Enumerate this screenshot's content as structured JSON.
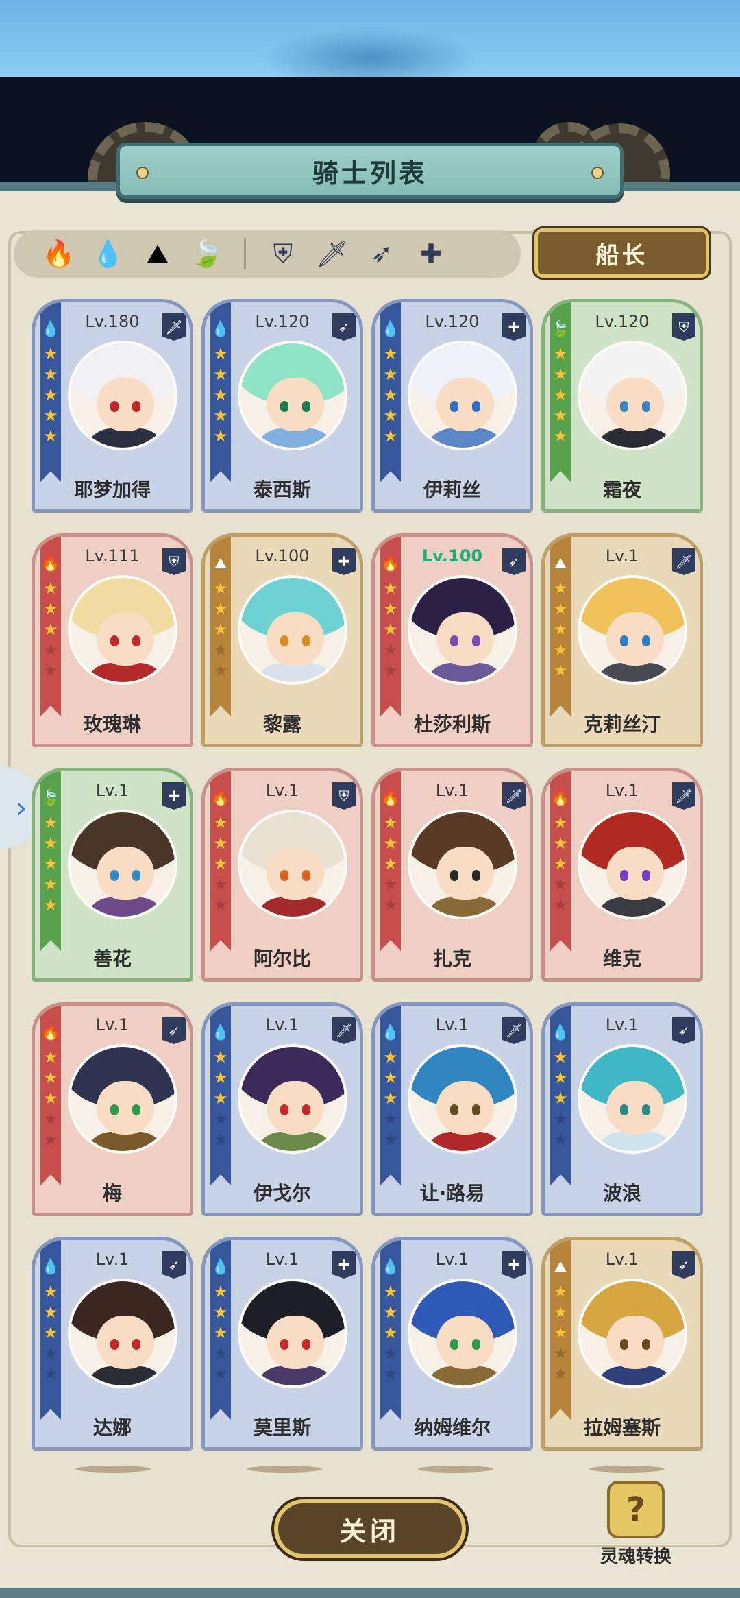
{
  "window": {
    "title": "骑士列表"
  },
  "filters": {
    "elements": [
      {
        "name": "fire",
        "glyph": "🔥"
      },
      {
        "name": "water",
        "glyph": "💧"
      },
      {
        "name": "earth",
        "glyph": "⛰"
      },
      {
        "name": "wind",
        "glyph": "🍃"
      }
    ],
    "classes": [
      {
        "name": "shield",
        "glyph": "⛨"
      },
      {
        "name": "sword",
        "glyph": "🗡"
      },
      {
        "name": "bow",
        "glyph": "➶"
      },
      {
        "name": "healer",
        "glyph": "✚"
      }
    ]
  },
  "captain_button": "船长",
  "close_button": "关闭",
  "soul_convert": {
    "icon": "?",
    "label": "灵魂转换"
  },
  "side_tab": "›",
  "knights": [
    {
      "name": "耶梦加得",
      "level": "Lv.180",
      "element": "water",
      "class": "sword",
      "stars": 5,
      "hair": "#f0f0f3",
      "eye": "#c0262a",
      "body": "#2b2f40"
    },
    {
      "name": "泰西斯",
      "level": "Lv.120",
      "element": "water",
      "class": "bow",
      "stars": 5,
      "hair": "#8fe4c8",
      "eye": "#1a7a50",
      "body": "#7fb0e0"
    },
    {
      "name": "伊莉丝",
      "level": "Lv.120",
      "element": "water",
      "class": "healer",
      "stars": 5,
      "hair": "#eef1f8",
      "eye": "#2f6fc4",
      "body": "#5b86c7"
    },
    {
      "name": "霜夜",
      "level": "Lv.120",
      "element": "wind",
      "class": "shield",
      "stars": 5,
      "hair": "#f3f3f3",
      "eye": "#3b86c2",
      "body": "#2c2c35"
    },
    {
      "name": "玫瑰琳",
      "level": "Lv.111",
      "element": "fire",
      "class": "shield",
      "stars": 3,
      "hair": "#f1dba0",
      "eye": "#c0262a",
      "body": "#b42a2a"
    },
    {
      "name": "黎露",
      "level": "Lv.100",
      "element": "earth",
      "class": "healer",
      "stars": 3,
      "hair": "#6fd2d2",
      "eye": "#d98a20",
      "body": "#d9e2ea"
    },
    {
      "name": "杜莎利斯",
      "level": "Lv.100",
      "element": "fire",
      "class": "bow",
      "stars": 3,
      "hair": "#2a2145",
      "eye": "#7c4bb0",
      "body": "#6a5a9a",
      "maxed": true
    },
    {
      "name": "克莉丝汀",
      "level": "Lv.1",
      "element": "earth",
      "class": "sword",
      "stars": 5,
      "hair": "#f2c25a",
      "eye": "#2f7ec4",
      "body": "#4a4a52"
    },
    {
      "name": "善花",
      "level": "Lv.1",
      "element": "wind",
      "class": "healer",
      "stars": 5,
      "hair": "#4a3628",
      "eye": "#2f8ac4",
      "body": "#6c4a8c"
    },
    {
      "name": "阿尔比",
      "level": "Lv.1",
      "element": "fire",
      "class": "shield",
      "stars": 3,
      "hair": "#e9e2d2",
      "eye": "#d8621c",
      "body": "#a32a2a"
    },
    {
      "name": "扎克",
      "level": "Lv.1",
      "element": "fire",
      "class": "sword",
      "stars": 3,
      "hair": "#5a3a24",
      "eye": "#2b2b2b",
      "body": "#8a6a34"
    },
    {
      "name": "维克",
      "level": "Lv.1",
      "element": "fire",
      "class": "sword",
      "stars": 3,
      "hair": "#b02a22",
      "eye": "#7a3fc4",
      "body": "#3a3a42"
    },
    {
      "name": "梅",
      "level": "Lv.1",
      "element": "fire",
      "class": "bow",
      "stars": 3,
      "hair": "#2f3550",
      "eye": "#2e9a4a",
      "body": "#7a5a2a"
    },
    {
      "name": "伊戈尔",
      "level": "Lv.1",
      "element": "water",
      "class": "sword",
      "stars": 3,
      "hair": "#3b2a5a",
      "eye": "#c4282a",
      "body": "#6b8a4a"
    },
    {
      "name": "让·路易",
      "level": "Lv.1",
      "element": "water",
      "class": "sword",
      "stars": 3,
      "hair": "#2f86c0",
      "eye": "#6a4a20",
      "body": "#b0282a"
    },
    {
      "name": "波浪",
      "level": "Lv.1",
      "element": "water",
      "class": "bow",
      "stars": 3,
      "hair": "#3fb7c4",
      "eye": "#2a8a8a",
      "body": "#cfe3ec"
    },
    {
      "name": "达娜",
      "level": "Lv.1",
      "element": "water",
      "class": "bow",
      "stars": 3,
      "hair": "#3a2820",
      "eye": "#c0262a",
      "body": "#2c2c35"
    },
    {
      "name": "莫里斯",
      "level": "Lv.1",
      "element": "water",
      "class": "healer",
      "stars": 3,
      "hair": "#1e1e26",
      "eye": "#c4282a",
      "body": "#4a3a6a"
    },
    {
      "name": "纳姆维尔",
      "level": "Lv.1",
      "element": "water",
      "class": "healer",
      "stars": 3,
      "hair": "#2f5ab8",
      "eye": "#2e9a4a",
      "body": "#8a6a34"
    },
    {
      "name": "拉姆塞斯",
      "level": "Lv.1",
      "element": "earth",
      "class": "bow",
      "stars": 3,
      "hair": "#d6a640",
      "eye": "#6a4a20",
      "body": "#2f3f7a"
    }
  ],
  "glyphs": {
    "elements": {
      "fire": "🔥",
      "water": "💧",
      "earth": "⛰",
      "wind": "🍃"
    },
    "classes": {
      "shield": "⛨",
      "sword": "🗡",
      "bow": "➶",
      "healer": "✚"
    }
  }
}
